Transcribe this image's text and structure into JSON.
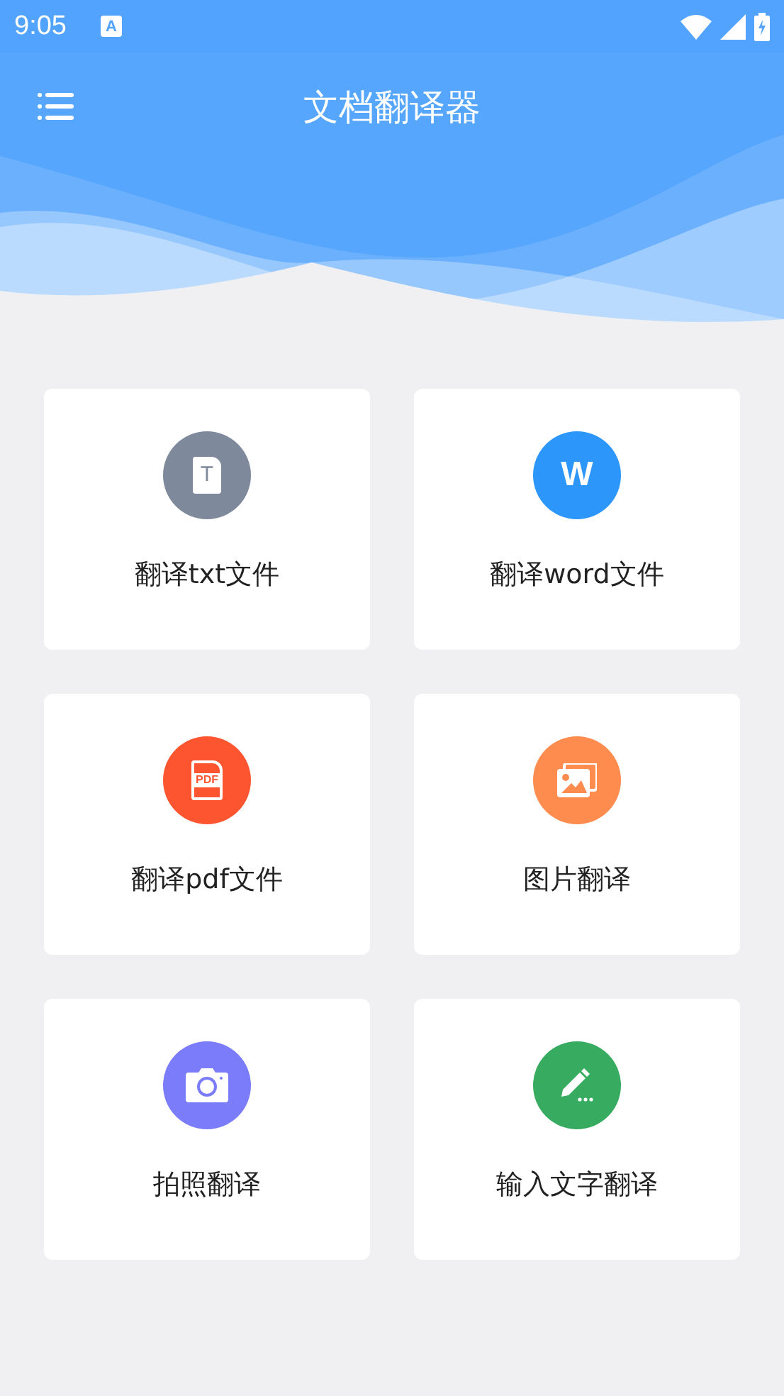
{
  "status_bar": {
    "time": "9:05",
    "notification_letter": "A"
  },
  "app_bar": {
    "title": "文档翻译器"
  },
  "cards": [
    {
      "label": "翻译txt文件",
      "kind": "txt",
      "color": "#7e8a9c",
      "icon_text": "T"
    },
    {
      "label": "翻译word文件",
      "kind": "word",
      "color": "#2d96fb",
      "icon_text": "W"
    },
    {
      "label": "翻译pdf文件",
      "kind": "pdf",
      "color": "#fd5530",
      "icon_text": "PDF"
    },
    {
      "label": "图片翻译",
      "kind": "image",
      "color": "#fe8c4f"
    },
    {
      "label": "拍照翻译",
      "kind": "camera",
      "color": "#7b7cf9"
    },
    {
      "label": "输入文字翻译",
      "kind": "text",
      "color": "#37ac60"
    }
  ]
}
